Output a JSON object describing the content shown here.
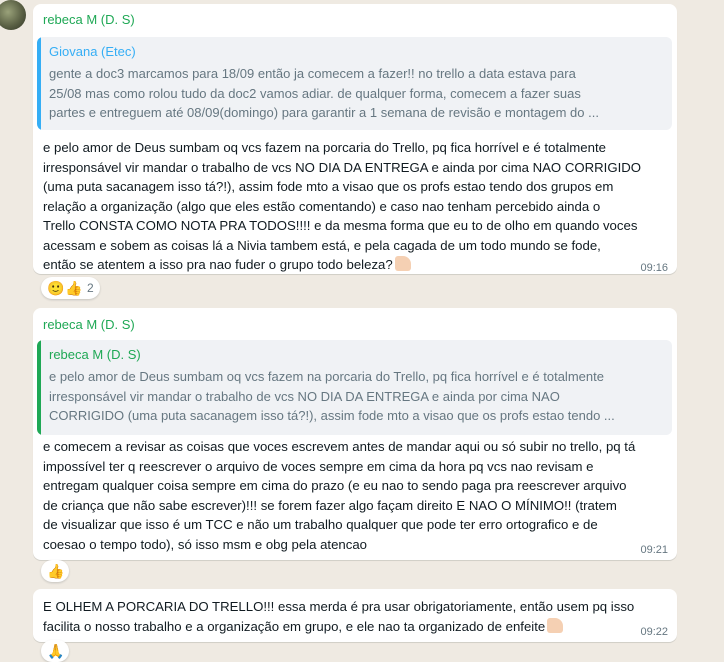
{
  "messages": [
    {
      "sender": "rebeca M (D. S)",
      "quote": {
        "author": "Giovana (Etec)",
        "lines": [
          "gente a doc3 marcamos para 18/09 então ja comecem a fazer!! no trello a data estava para",
          "25/08 mas como rolou tudo da doc2 vamos adiar. de qualquer forma, comecem a fazer suas",
          "partes e entreguem até 08/09(domingo) para garantir a 1 semana de revisão e montagem do ..."
        ]
      },
      "lines": [
        "e pelo amor de Deus sumbam oq vcs fazem na porcaria do Trello, pq fica horrível e é totalmente",
        "irresponsável vir mandar o trabalho de vcs NO DIA DA ENTREGA e ainda por cima NAO CORRIGIDO",
        "(uma puta sacanagem isso tá?!), assim fode mto a visao que os profs estao tendo dos grupos em",
        "relação a organização (algo que eles estão comentando) e caso nao tenham percebido ainda o",
        "Trello CONSTA COMO NOTA PRA TODOS!!!! e da mesma forma que eu to de olho em quando voces",
        "acessam e sobem as coisas lá a Nivia tambem está, e pela cagada de um todo mundo se fode,",
        "então se atentem a isso pra nao fuder o grupo todo beleza?"
      ],
      "time": "09:16",
      "reactions": {
        "emojis": [
          "🙂",
          "👍"
        ],
        "count": "2"
      }
    },
    {
      "sender": "rebeca M (D. S)",
      "quote": {
        "author": "rebeca M (D. S)",
        "lines": [
          "e pelo amor de Deus sumbam oq vcs fazem na porcaria do Trello, pq fica horrível e é totalmente",
          "irresponsável vir mandar o trabalho de vcs NO DIA DA ENTREGA e ainda por cima NAO",
          "CORRIGIDO (uma puta sacanagem isso tá?!), assim fode mto a visao que os profs estao tendo ..."
        ]
      },
      "lines": [
        "e comecem a revisar as coisas que voces escrevem antes de mandar aqui ou só subir no trello, pq tá",
        "impossível ter q reescrever o arquivo de voces sempre em cima da hora pq vcs nao revisam e",
        "entregam qualquer coisa sempre em cima do prazo (e eu nao to sendo paga pra reescrever arquivo",
        "de criança que não sabe escrever)!!! se forem fazer algo façam direito E NAO O MÍNIMO!! (tratem",
        "de visualizar que isso é um TCC e não um trabalho qualquer que pode ter erro ortografico e de",
        "coesao o tempo todo), só isso msm e obg pela atencao"
      ],
      "time": "09:21",
      "reactions": {
        "emojis": [
          "👍"
        ]
      }
    },
    {
      "lines": [
        "E OLHEM A PORCARIA DO TRELLO!!! essa merda é pra usar obrigatoriamente, então usem pq isso",
        "facilita o nosso trabalho e a organização em grupo, e ele nao ta organizado de enfeite"
      ],
      "time": "09:22",
      "reactions": {
        "emojis": [
          "🙏"
        ]
      }
    }
  ]
}
